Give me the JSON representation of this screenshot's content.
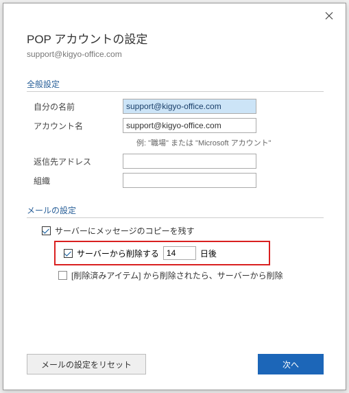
{
  "dialog": {
    "title": "POP アカウントの設定",
    "subtitle": "support@kigyo-office.com"
  },
  "general": {
    "header": "全般設定",
    "name_label": "自分の名前",
    "name_value": "support@kigyo-office.com",
    "account_label": "アカウント名",
    "account_value": "support@kigyo-office.com",
    "account_hint": "例: \"職場\" または \"Microsoft アカウント\"",
    "reply_label": "返信先アドレス",
    "reply_value": "",
    "org_label": "組織",
    "org_value": ""
  },
  "mail": {
    "header": "メールの設定",
    "leave_copy_label": "サーバーにメッセージのコピーを残す",
    "delete_after_label": "サーバーから削除する",
    "delete_after_days": "14",
    "delete_after_suffix": "日後",
    "remove_if_deleted_label": "[削除済みアイテム] から削除されたら、サーバーから削除"
  },
  "footer": {
    "reset_label": "メールの設定をリセット",
    "next_label": "次へ"
  }
}
